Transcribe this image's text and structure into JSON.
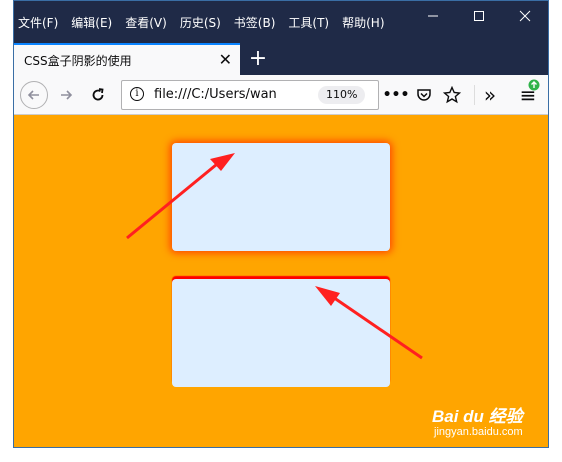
{
  "menu": {
    "items": [
      "文件(F)",
      "编辑(E)",
      "查看(V)",
      "历史(S)",
      "书签(B)",
      "工具(T)",
      "帮助(H)"
    ]
  },
  "window_controls": {
    "minimize": "—",
    "maximize": "☐",
    "close": "✕"
  },
  "tab": {
    "title": "CSS盒子阴影的使用",
    "close": "✕"
  },
  "new_tab": "+",
  "navbar": {
    "back": "←",
    "forward": "→",
    "reload": "↻",
    "url": "file:///C:/Users/wan",
    "zoom": "110%",
    "more": "•••",
    "overflow": "»",
    "menu": "≡"
  },
  "colors": {
    "page_background": "#ffa500",
    "box_fill": "#ddeeff",
    "shadow_box1": "#ff4500",
    "shadow_box2": "#ff0000",
    "arrow": "#ff2020"
  },
  "watermark": {
    "logo": "Bai du 经验",
    "url": "jingyan.baidu.com"
  }
}
